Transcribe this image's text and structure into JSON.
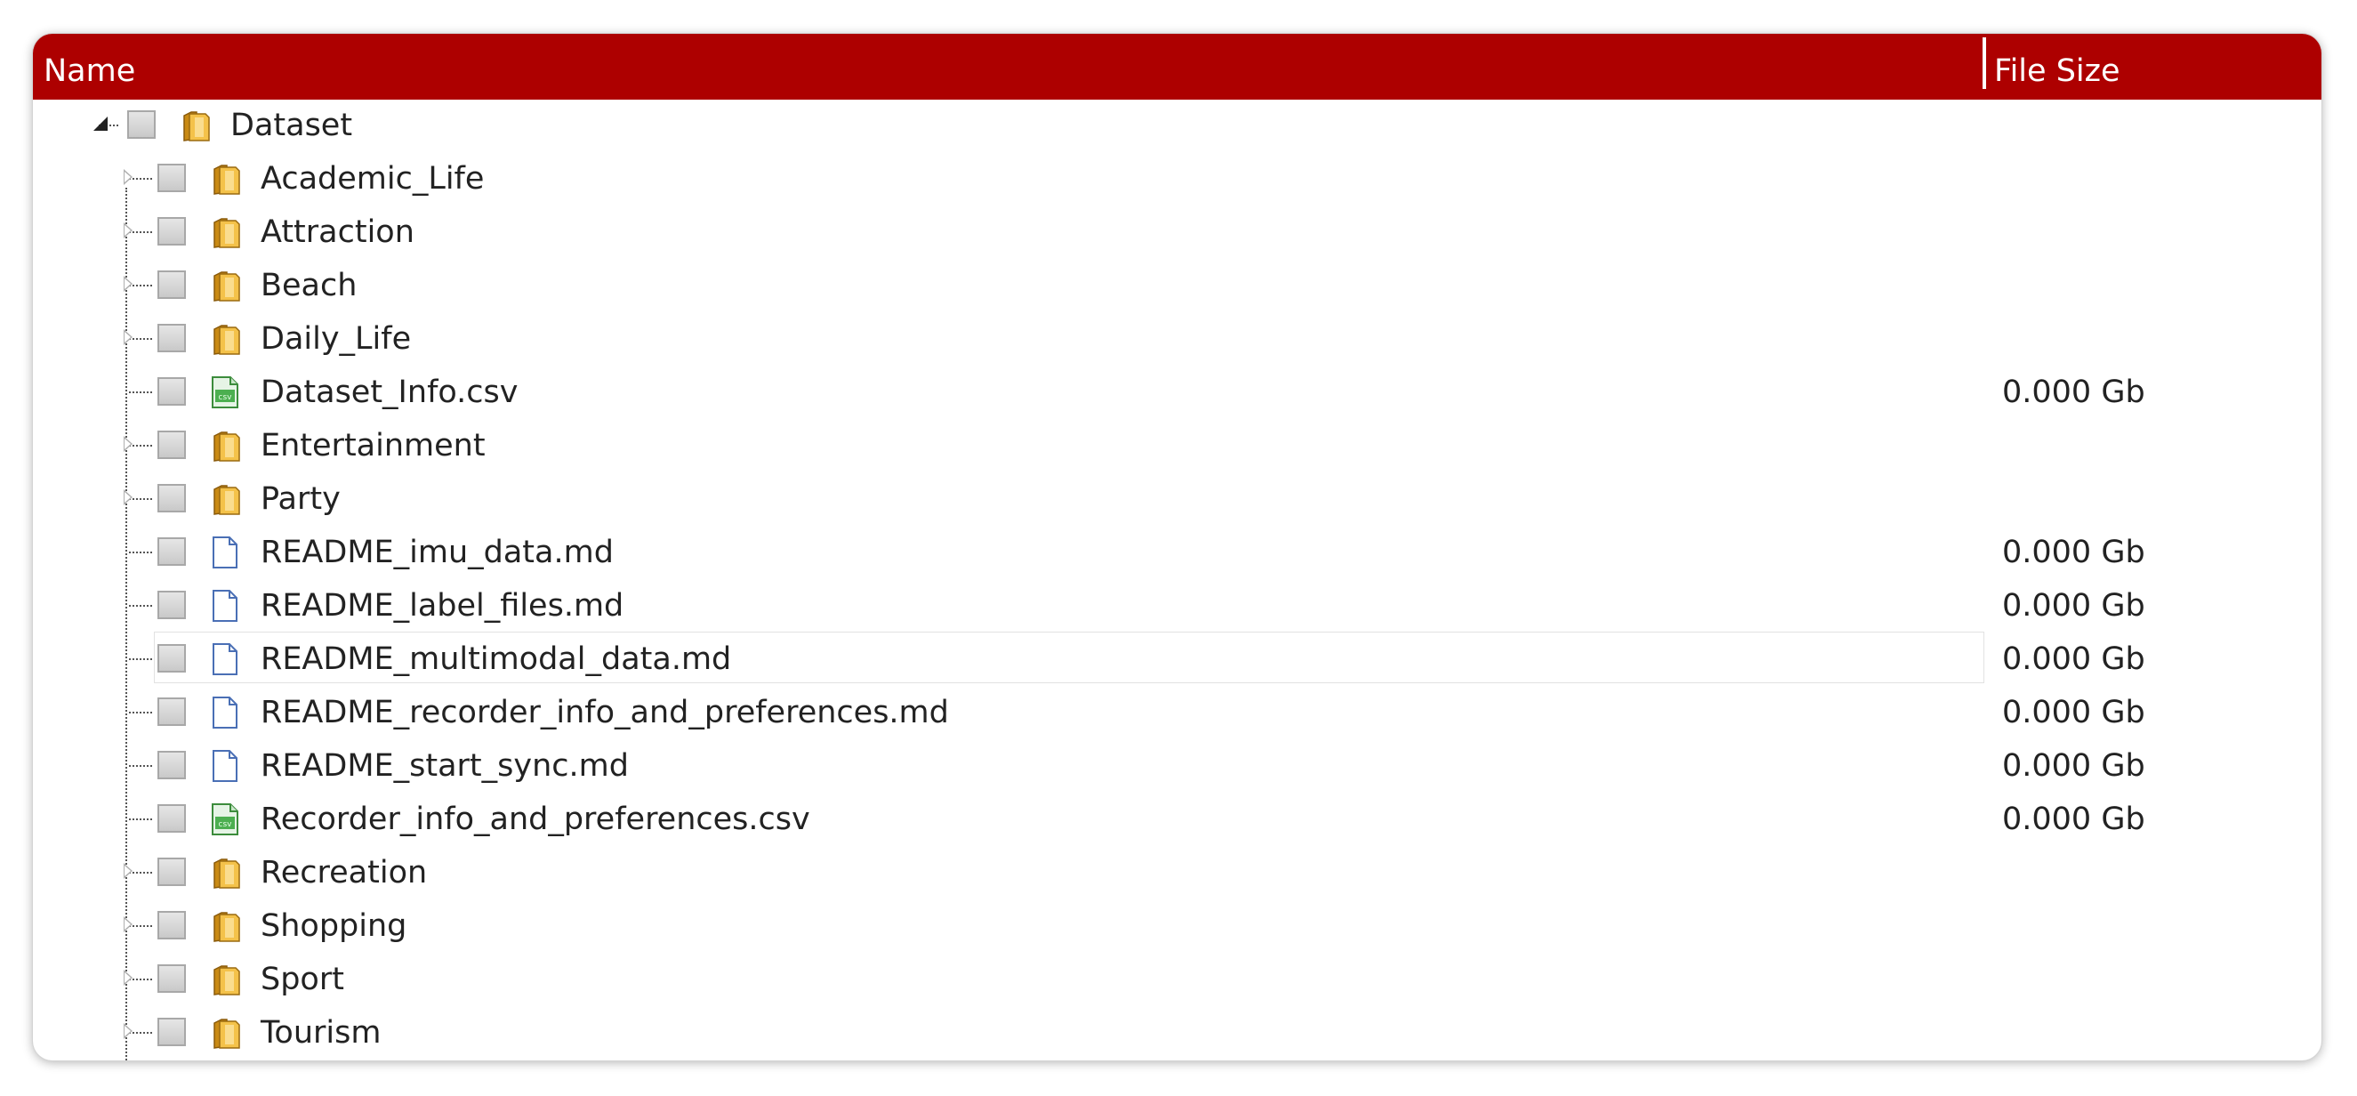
{
  "header": {
    "name_label": "Name",
    "size_label": "File Size"
  },
  "colors": {
    "header_bg": "#ad0000",
    "folder": "#f0b429",
    "csv_icon": "#4caf50",
    "doc_icon": "#4a6fb5"
  },
  "root": {
    "label": "Dataset",
    "icon": "folder-icon",
    "expanded": true
  },
  "items": [
    {
      "label": "Academic_Life",
      "icon": "folder-icon",
      "size": ""
    },
    {
      "label": "Attraction",
      "icon": "folder-icon",
      "size": ""
    },
    {
      "label": "Beach",
      "icon": "folder-icon",
      "size": ""
    },
    {
      "label": "Daily_Life",
      "icon": "folder-icon",
      "size": ""
    },
    {
      "label": "Dataset_Info.csv",
      "icon": "csv-file-icon",
      "size": "0.000 Gb"
    },
    {
      "label": "Entertainment",
      "icon": "folder-icon",
      "size": ""
    },
    {
      "label": "Party",
      "icon": "folder-icon",
      "size": ""
    },
    {
      "label": "README_imu_data.md",
      "icon": "document-icon",
      "size": "0.000 Gb"
    },
    {
      "label": "README_label_files.md",
      "icon": "document-icon",
      "size": "0.000 Gb"
    },
    {
      "label": "README_multimodal_data.md",
      "icon": "document-icon",
      "size": "0.000 Gb",
      "hovered": true
    },
    {
      "label": "README_recorder_info_and_preferences.md",
      "icon": "document-icon",
      "size": "0.000 Gb"
    },
    {
      "label": "README_start_sync.md",
      "icon": "document-icon",
      "size": "0.000 Gb"
    },
    {
      "label": "Recorder_info_and_preferences.csv",
      "icon": "csv-file-icon",
      "size": "0.000 Gb"
    },
    {
      "label": "Recreation",
      "icon": "folder-icon",
      "size": ""
    },
    {
      "label": "Shopping",
      "icon": "folder-icon",
      "size": ""
    },
    {
      "label": "Sport",
      "icon": "folder-icon",
      "size": ""
    },
    {
      "label": "Tourism",
      "icon": "folder-icon",
      "size": ""
    }
  ]
}
